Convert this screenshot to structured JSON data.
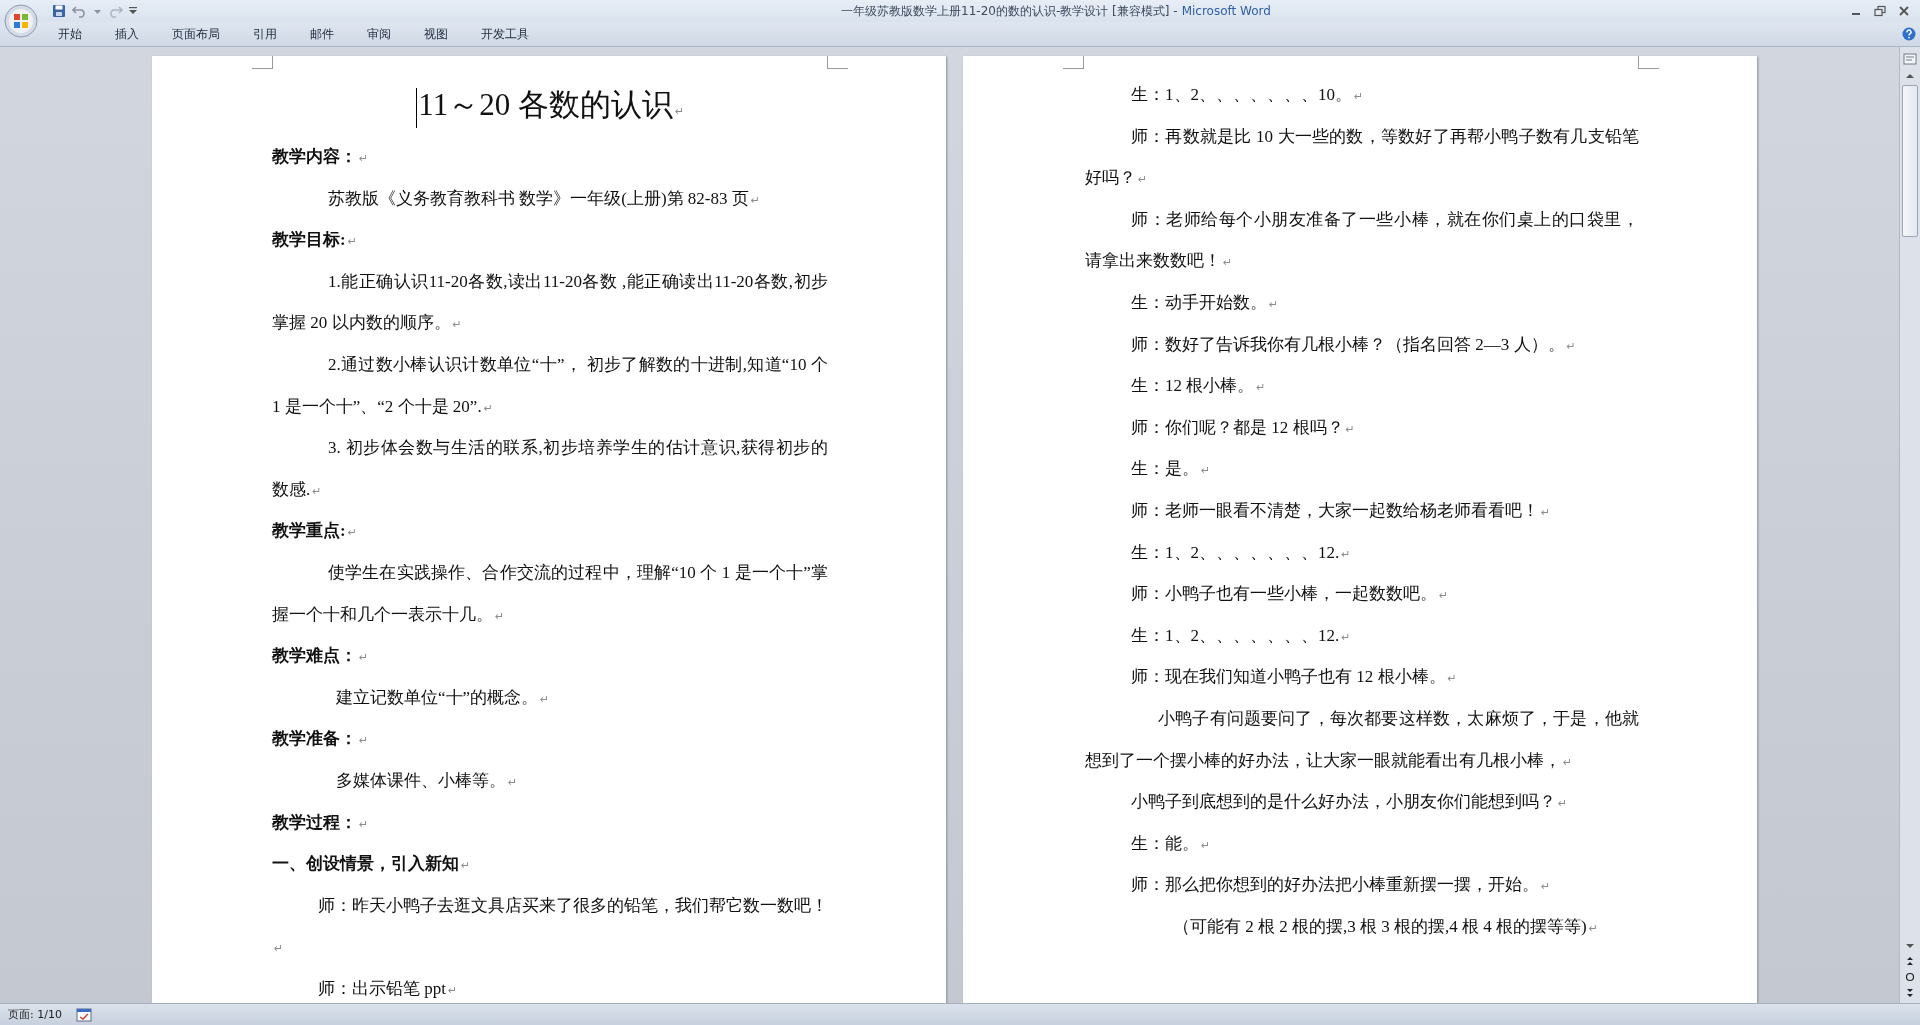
{
  "window": {
    "document_title": "一年级苏教版数学上册11-20的数的认识-教学设计 [兼容模式] -",
    "app_name": "Microsoft Word"
  },
  "ribbon_tabs": [
    {
      "label": "开始"
    },
    {
      "label": "插入"
    },
    {
      "label": "页面布局"
    },
    {
      "label": "引用"
    },
    {
      "label": "邮件"
    },
    {
      "label": "审阅"
    },
    {
      "label": "视图"
    },
    {
      "label": "开发工具"
    }
  ],
  "pages": [
    {
      "paragraphs": [
        {
          "kind": "title",
          "text": "11～20 各数的认识",
          "mark": "↵"
        },
        {
          "kind": "heading",
          "text": "教学内容：",
          "mark": "↵"
        },
        {
          "kind": "paragraph",
          "text": "苏教版《义务教育教科书 数学》一年级(上册)第 82-83 页",
          "mark": "↵"
        },
        {
          "kind": "heading",
          "text": "教学目标:",
          "mark": "↵"
        },
        {
          "kind": "paragraph",
          "text": "1.能正确认识11-20各数,读出11-20各数 ,能正确读出11-20各数,初步掌握 20 以内数的顺序。",
          "mark": "↵"
        },
        {
          "kind": "paragraph",
          "text": "2.通过数小棒认识计数单位“十”， 初步了解数的十进制,知道“10 个 1 是一个十”、“2 个十是 20”.",
          "mark": "↵"
        },
        {
          "kind": "paragraph",
          "text": "3. 初步体会数与生活的联系,初步培养学生的估计意识,获得初步的数感.",
          "mark": "↵"
        },
        {
          "kind": "heading",
          "text": "教学重点:",
          "mark": "↵"
        },
        {
          "kind": "paragraph",
          "text": "使学生在实践操作、合作交流的过程中，理解“10 个 1 是一个十”掌握一个十和几个一表示十几。",
          "mark": "↵"
        },
        {
          "kind": "heading",
          "text": "教学难点：",
          "mark": "↵"
        },
        {
          "kind": "detail",
          "text": "建立记数单位“十”的概念。",
          "mark": "↵"
        },
        {
          "kind": "heading",
          "text": "教学准备：",
          "mark": "↵"
        },
        {
          "kind": "detail",
          "text": "多媒体课件、小棒等。",
          "mark": "↵"
        },
        {
          "kind": "heading",
          "text": "教学过程：",
          "mark": "↵"
        },
        {
          "kind": "heading",
          "text": "一、创设情景，引入新知",
          "mark": "↵"
        },
        {
          "kind": "dialogue",
          "text": "师：昨天小鸭子去逛文具店买来了很多的铅笔，我们帮它数一数吧！",
          "mark": "↵"
        },
        {
          "kind": "dialogue",
          "text": "师：出示铅笔 ppt",
          "mark": "↵"
        }
      ]
    },
    {
      "paragraphs": [
        {
          "kind": "dialogue",
          "text": "生：1、2、、、、、、、10。",
          "mark": "↵"
        },
        {
          "kind": "dialogue",
          "text": "师：再数就是比 10 大一些的数，等数好了再帮小鸭子数有几支铅笔好吗？",
          "mark": "↵"
        },
        {
          "kind": "dialogue",
          "text": "师：老师给每个小朋友准备了一些小棒，就在你们桌上的口袋里，请拿出来数数吧！",
          "mark": "↵"
        },
        {
          "kind": "dialogue",
          "text": "生：动手开始数。",
          "mark": "↵"
        },
        {
          "kind": "dialogue",
          "text": "师：数好了告诉我你有几根小棒？（指名回答 2—3 人）。",
          "mark": "↵"
        },
        {
          "kind": "dialogue",
          "text": "生：12 根小棒。",
          "mark": "↵"
        },
        {
          "kind": "dialogue",
          "text": "师：你们呢？都是 12 根吗？",
          "mark": "↵"
        },
        {
          "kind": "dialogue",
          "text": "生：是。",
          "mark": "↵"
        },
        {
          "kind": "dialogue",
          "text": "师：老师一眼看不清楚，大家一起数给杨老师看看吧！",
          "mark": "↵"
        },
        {
          "kind": "dialogue",
          "text": "生：1、2、、、、、、、12.",
          "mark": "↵"
        },
        {
          "kind": "dialogue",
          "text": "师：小鸭子也有一些小棒，一起数数吧。",
          "mark": "↵"
        },
        {
          "kind": "dialogue",
          "text": "生：1、2、、、、、、、12.",
          "mark": "↵"
        },
        {
          "kind": "dialogue",
          "text": "师：现在我们知道小鸭子也有 12 根小棒。",
          "mark": "↵"
        },
        {
          "kind": "story",
          "text": "小鸭子有问题要问了，每次都要这样数，太麻烦了，于是，他就想到了一个摆小棒的好办法，让大家一眼就能看出有几根小棒，",
          "mark": "↵"
        },
        {
          "kind": "dialogue",
          "text": "小鸭子到底想到的是什么好办法，小朋友你们能想到吗？",
          "mark": "↵"
        },
        {
          "kind": "dialogue",
          "text": "生：能。",
          "mark": "↵"
        },
        {
          "kind": "dialogue",
          "text": "师：那么把你想到的好办法把小棒重新摆一摆，开始。",
          "mark": "↵"
        },
        {
          "kind": "aside",
          "text": "（可能有 2 根 2 根的摆,3 根 3 根的摆,4 根 4 根的摆等等)",
          "mark": "↵"
        }
      ]
    }
  ],
  "status_bar": {
    "page": "页面: 1/10"
  }
}
